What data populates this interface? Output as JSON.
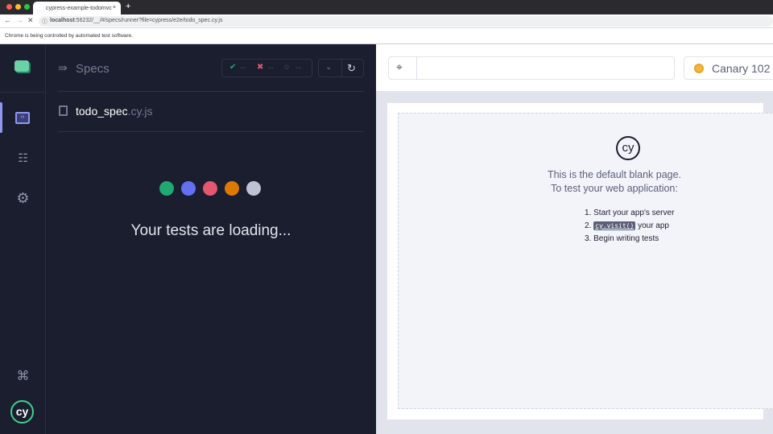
{
  "browser": {
    "tab_title": "cypress-example-todomvc",
    "new_tab": "+",
    "url_host": "localhost",
    "url_rest": ":56232/__/#/specs/runner?file=cypress/e2e/todo_spec.cy.js",
    "info_bar": "Chrome is being controlled by automated test software."
  },
  "specs": {
    "title": "Specs",
    "passed": "--",
    "failed": "--",
    "pending": "--",
    "file_name": "todo_spec",
    "file_ext": ".cy.js",
    "loading_text": "Your tests are loading...",
    "dot_colors": [
      "#1fa971",
      "#6470f3",
      "#e45770",
      "#db7903",
      "#bfc2d4"
    ]
  },
  "runner": {
    "url_value": "",
    "browser_label": "Canary 102"
  },
  "blank_page": {
    "logo": "cy",
    "line1": "This is the default blank page.",
    "line2": "To test your web application:",
    "steps": [
      "Start your app's server",
      "your app",
      "Begin writing tests"
    ],
    "step_numbers": [
      "1.",
      "2.",
      "3."
    ],
    "code": "cy.visit()"
  }
}
